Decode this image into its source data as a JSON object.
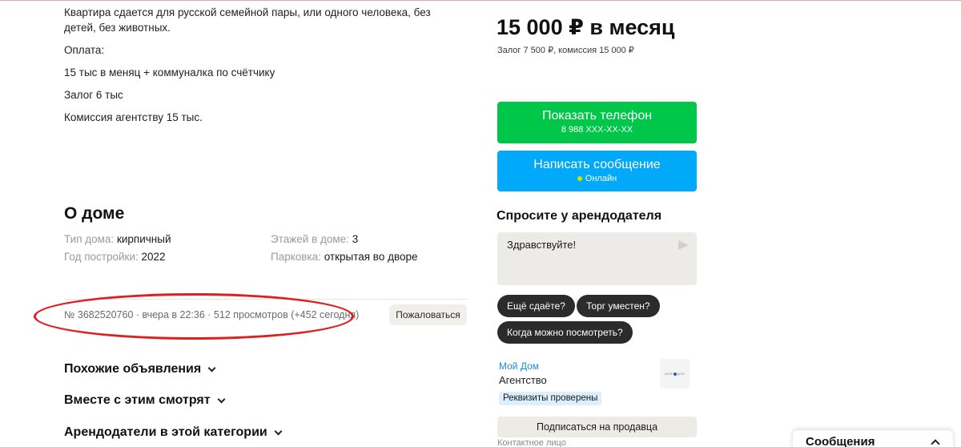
{
  "description": {
    "lines": [
      "Квартира сдается для русской семейной пары, или одного человека, без детей, без животных.",
      "Оплата:",
      "15 тыс в меняц + коммуналка по счётчику",
      "Залог 6 тыс",
      "Комиссия агентству 15 тыс."
    ]
  },
  "about_house": {
    "title": "О доме",
    "params": [
      {
        "label": "Тип дома:",
        "value": "кирпичный"
      },
      {
        "label": "Этажей в доме:",
        "value": "3"
      },
      {
        "label": "Год постройки:",
        "value": "2022"
      },
      {
        "label": "Парковка:",
        "value": "открытая во дворе"
      }
    ]
  },
  "listing_meta": {
    "text": "№ 3682520760 · вчера в 22:36 · 512 просмотров (+452 сегодня)",
    "report_label": "Пожаловаться",
    "highlight_color": "#e11d1d"
  },
  "sections": [
    {
      "label": "Похожие объявления"
    },
    {
      "label": "Вместе с этим смотрят"
    },
    {
      "label": "Арендодатели в этой категории"
    }
  ],
  "price": {
    "main": "15 000 ₽ в месяц",
    "details": "Залог 7 500 ₽, комиссия 15 000 ₽"
  },
  "contact_buttons": {
    "phone_label": "Показать телефон",
    "phone_masked": "8 988 XXX-XX-XX",
    "message_label": "Написать сообщение",
    "online_status": "Онлайн",
    "phone_color": "#00c64a",
    "message_color": "#00a9f9"
  },
  "ask": {
    "title": "Спросите у арендодателя",
    "input_value": "Здравствуйте!",
    "quick_questions": [
      "Ещё сдаёте?",
      "Торг уместен?",
      "Когда можно посмотреть?"
    ]
  },
  "seller": {
    "name": "Мой Дом",
    "type": "Агентство",
    "badge": "Реквизиты проверены",
    "logo_text": "МОЙ ДОМ",
    "subscribe_label": "Подписаться на продавца",
    "contact_label": "Контактное лицо"
  },
  "messages_widget": {
    "label": "Сообщения"
  }
}
